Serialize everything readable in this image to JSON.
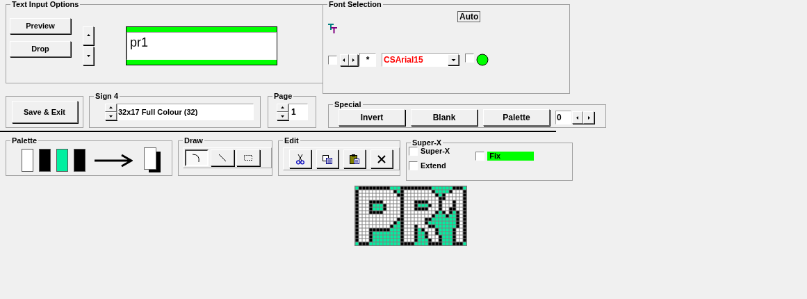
{
  "text_input_options": {
    "title": "Text Input Options",
    "buttons": [
      {
        "label": "Preview"
      },
      {
        "label": "Drop"
      }
    ],
    "text_value": "pr1"
  },
  "font_selection": {
    "title": "Font Selection",
    "auto_label": "Auto",
    "bold_checked": false,
    "spin_value": "*",
    "font": "CSArial15",
    "color_checked": false
  },
  "save_button": {
    "label": "Save & Exit"
  },
  "sign": {
    "title": "Sign 4",
    "value": "32x17 Full Colour (32)"
  },
  "page": {
    "title": "Page",
    "value": "1"
  },
  "special": {
    "title": "Special",
    "buttons": [
      {
        "label": "Invert"
      },
      {
        "label": "Blank"
      },
      {
        "label": "Palette"
      }
    ],
    "value": "0"
  },
  "palette": {
    "title": "Palette",
    "swatches": [
      {
        "color": "#ffffff"
      },
      {
        "color": "#000000"
      },
      {
        "color": "#00f0a0"
      },
      {
        "color": "#000000"
      }
    ]
  },
  "draw": {
    "title": "Draw",
    "tools": [
      {
        "kind": "curve",
        "selected": true
      },
      {
        "kind": "line",
        "selected": false
      },
      {
        "kind": "rectangle",
        "selected": false
      }
    ]
  },
  "edit": {
    "title": "Edit",
    "tools": [
      {
        "kind": "cut"
      },
      {
        "kind": "copy"
      },
      {
        "kind": "paste"
      },
      {
        "kind": "delete"
      }
    ]
  },
  "super_x": {
    "title": "Super-X",
    "options": [
      {
        "label": "Super-X",
        "checked": false
      },
      {
        "label": "Extend",
        "checked": false
      },
      {
        "label": "Fix",
        "checked": false
      }
    ]
  }
}
